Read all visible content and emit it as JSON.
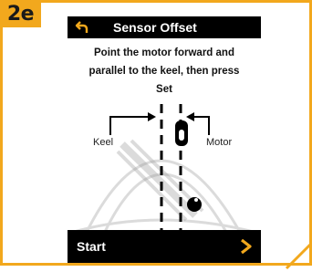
{
  "step_badge": "2e",
  "screen": {
    "title": "Sensor Offset",
    "instruction_lines": [
      "Point the motor forward and",
      "parallel to the keel, then press",
      "Set"
    ],
    "labels": {
      "keel": "Keel",
      "motor": "Motor"
    },
    "footer": {
      "start_label": "Start"
    }
  },
  "icons": {
    "back": "back-arrow-icon",
    "next": "chevron-right-icon"
  },
  "colors": {
    "accent": "#f2a81d",
    "header_bg": "#000000",
    "header_text": "#ffffff",
    "chevron": "#f2a81d"
  }
}
